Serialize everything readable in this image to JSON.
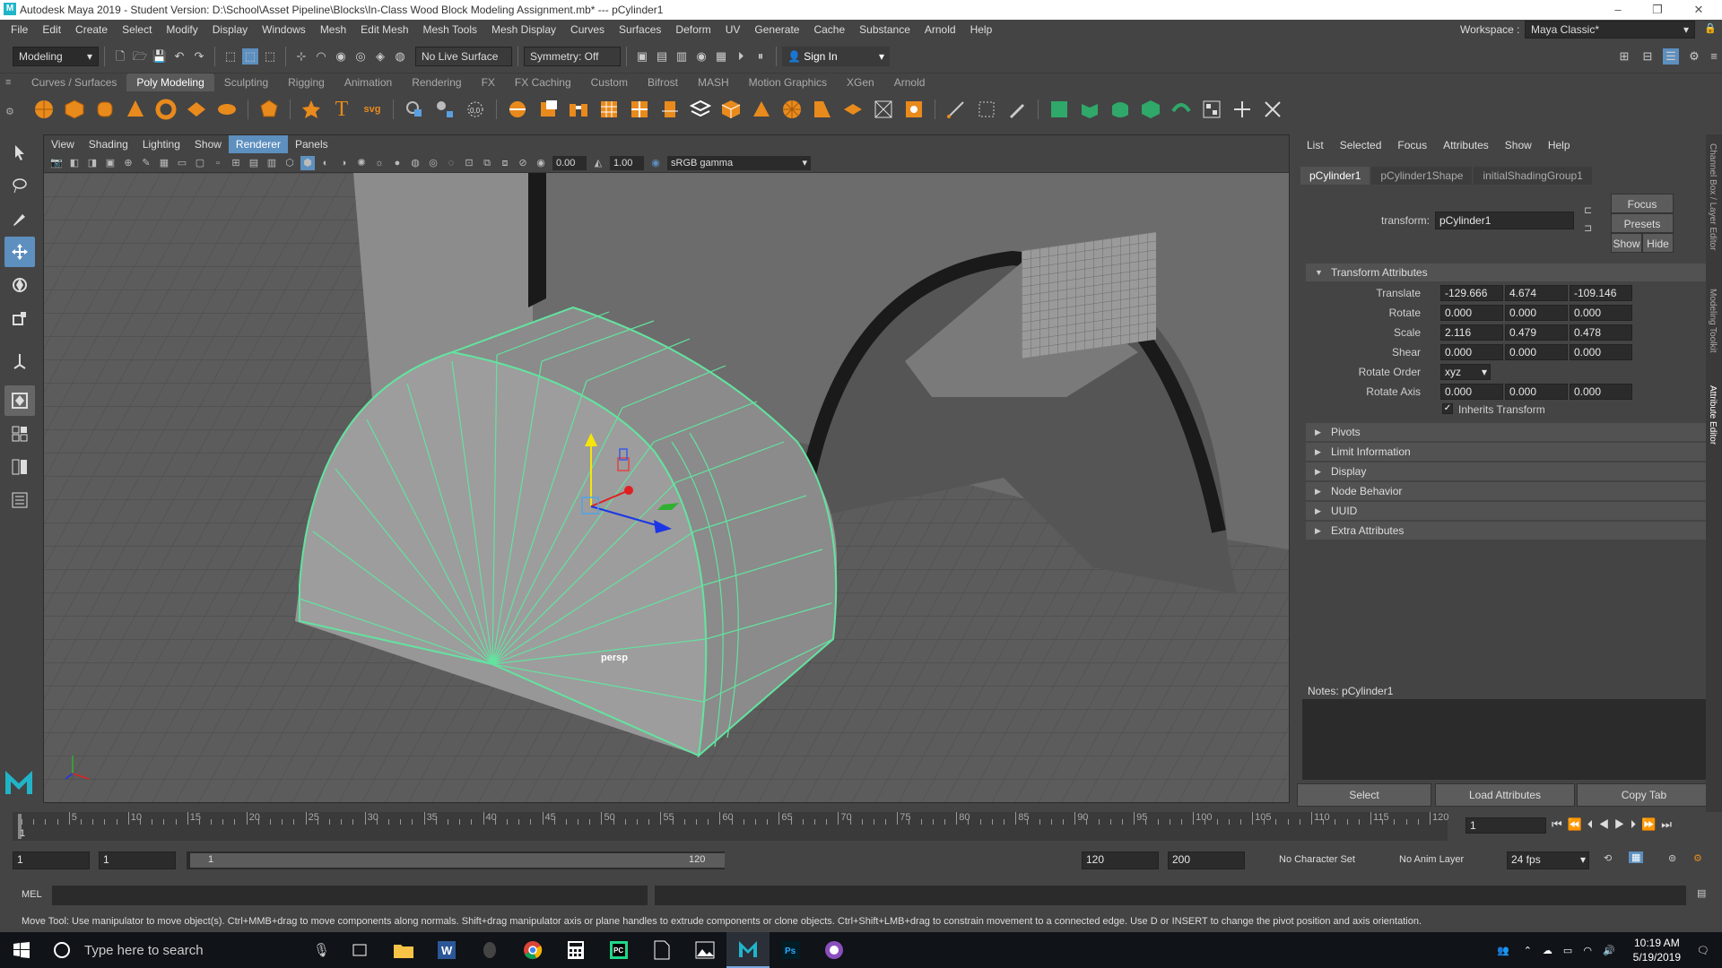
{
  "window": {
    "title": "Autodesk Maya 2019 - Student Version: D:\\School\\Asset Pipeline\\Blocks\\In-Class Wood Block Modeling Assignment.mb*  ---  pCylinder1",
    "minimize": "–",
    "maximize": "❐",
    "close": "✕"
  },
  "menus": [
    "File",
    "Edit",
    "Create",
    "Select",
    "Modify",
    "Display",
    "Windows",
    "Mesh",
    "Edit Mesh",
    "Mesh Tools",
    "Mesh Display",
    "Curves",
    "Surfaces",
    "Deform",
    "UV",
    "Generate",
    "Cache",
    "Substance",
    "Arnold",
    "Help"
  ],
  "workspace": {
    "label": "Workspace :",
    "value": "Maya Classic*"
  },
  "statusline": {
    "menuset": "Modeling",
    "live_surface": "No Live Surface",
    "symmetry": "Symmetry: Off",
    "sign_in": "Sign In"
  },
  "shelf_tabs": [
    "Curves / Surfaces",
    "Poly Modeling",
    "Sculpting",
    "Rigging",
    "Animation",
    "Rendering",
    "FX",
    "FX Caching",
    "Custom",
    "Bifrost",
    "MASH",
    "Motion Graphics",
    "XGen",
    "Arnold"
  ],
  "active_shelf_tab": "Poly Modeling",
  "viewport": {
    "menus": [
      "View",
      "Shading",
      "Lighting",
      "Show",
      "Renderer",
      "Panels"
    ],
    "active_menu": "Renderer",
    "exposure": "0.00",
    "gamma": "1.00",
    "color_space": "sRGB gamma",
    "camera": "persp"
  },
  "attribute_editor": {
    "menus": [
      "List",
      "Selected",
      "Focus",
      "Attributes",
      "Show",
      "Help"
    ],
    "tabs": [
      "pCylinder1",
      "pCylinder1Shape",
      "initialShadingGroup1"
    ],
    "transform_label": "transform:",
    "transform_value": "pCylinder1",
    "buttons": {
      "focus": "Focus",
      "presets": "Presets",
      "show": "Show",
      "hide": "Hide"
    },
    "section_transform": "Transform Attributes",
    "translate": {
      "label": "Translate",
      "values": [
        "-129.666",
        "4.674",
        "-109.146"
      ]
    },
    "rotate": {
      "label": "Rotate",
      "values": [
        "0.000",
        "0.000",
        "0.000"
      ]
    },
    "scale": {
      "label": "Scale",
      "values": [
        "2.116",
        "0.479",
        "0.478"
      ]
    },
    "shear": {
      "label": "Shear",
      "values": [
        "0.000",
        "0.000",
        "0.000"
      ]
    },
    "rotate_order": {
      "label": "Rotate Order",
      "value": "xyz"
    },
    "rotate_axis": {
      "label": "Rotate Axis",
      "values": [
        "0.000",
        "0.000",
        "0.000"
      ]
    },
    "inherits": "Inherits Transform",
    "sections": [
      "Pivots",
      "Limit Information",
      "Display",
      "Node Behavior",
      "UUID",
      "Extra Attributes"
    ],
    "notes": "Notes:  pCylinder1",
    "bottom_buttons": [
      "Select",
      "Load Attributes",
      "Copy Tab"
    ]
  },
  "side_tabs": [
    "Channel Box / Layer Editor",
    "Modeling Toolkit",
    "Attribute Editor"
  ],
  "timeline": {
    "ticks": [
      "5",
      "10",
      "15",
      "20",
      "25",
      "30",
      "35",
      "40",
      "45",
      "50",
      "55",
      "60",
      "65",
      "70",
      "75",
      "80",
      "85",
      "90",
      "95",
      "100",
      "105",
      "110",
      "115",
      "120"
    ],
    "current_frame": "1",
    "current_marker": "1"
  },
  "range": {
    "start": "1",
    "playback_start": "1",
    "slider_start": "1",
    "slider_end": "120",
    "playback_end": "120",
    "end": "200",
    "character_set": "No Character Set",
    "anim_layer": "No Anim Layer",
    "fps": "24 fps"
  },
  "cmdline": {
    "label": "MEL"
  },
  "help_line": "Move Tool: Use manipulator to move object(s). Ctrl+MMB+drag to move components along normals. Shift+drag manipulator axis or plane handles to extrude components or clone objects. Ctrl+Shift+LMB+drag to constrain movement to a connected edge. Use D or INSERT to change the pivot position and axis orientation.",
  "taskbar": {
    "search_placeholder": "Type here to search",
    "time": "10:19 AM",
    "date": "5/19/2019"
  }
}
